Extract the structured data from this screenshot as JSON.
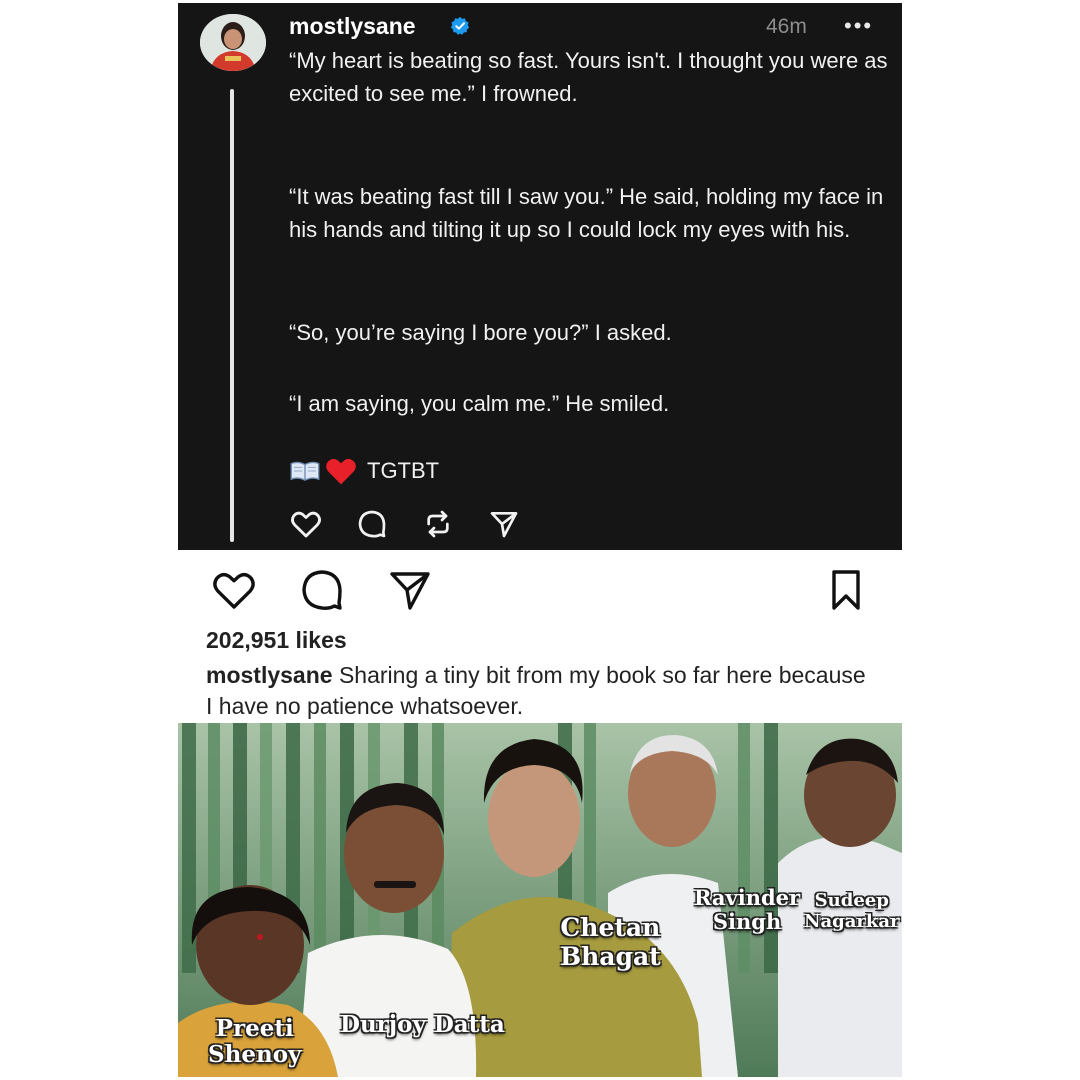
{
  "thread": {
    "username": "mostlysane",
    "time": "46m",
    "more_label": "•••",
    "paragraphs": [
      "“My heart is beating so fast. Yours isn't. I thought you were as excited to see me.” I frowned.",
      "“It was beating fast till I saw you.” He said, holding my face in his hands and tilting it up so I could lock my eyes with his.",
      "“So, you’re saying I bore you?” I asked.",
      "“I am saying, you calm me.” He smiled."
    ],
    "signature_emojis": [
      "open-book",
      "red-heart"
    ],
    "signature_text": "TGTBT",
    "action_icons": [
      "heart-icon",
      "comment-icon",
      "repost-icon",
      "share-icon"
    ]
  },
  "post": {
    "action_icons": [
      "heart-icon",
      "comment-icon",
      "send-icon",
      "bookmark-icon"
    ],
    "likes": "202,951 likes",
    "caption_user": "mostlysane",
    "caption_text": "Sharing a tiny bit from my book so far here because I have no patience whatsoever."
  },
  "meme": {
    "labels": {
      "chetan_line1": "Chetan",
      "chetan_line2": "Bhagat",
      "ravinder_line1": "Ravinder",
      "ravinder_line2": "Singh",
      "sudeep_line1": "Sudeep",
      "sudeep_line2": "Nagarkar",
      "durjoy": "Durjoy Datta",
      "preeti_line1": "Preeti",
      "preeti_line2": "Shenoy"
    }
  },
  "colors": {
    "thread_bg": "#151515",
    "verified_blue": "#1d9bf0",
    "text_light": "#f0f0f0",
    "text_dark": "#222222"
  }
}
